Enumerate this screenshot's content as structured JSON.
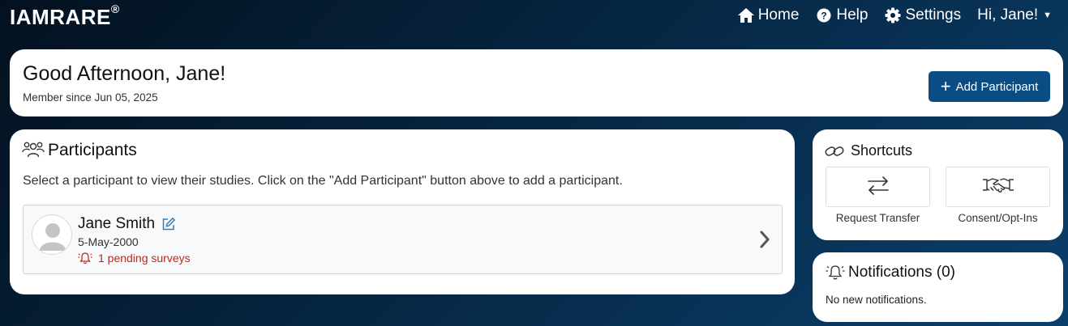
{
  "brand": {
    "name": "IAMRARE",
    "mark": "®"
  },
  "nav": {
    "home": "Home",
    "help": "Help",
    "settings": "Settings",
    "user": "Hi, Jane!"
  },
  "welcome": {
    "greeting": "Good Afternoon, Jane!",
    "member_since": "Member since Jun 05, 2025",
    "add_button": "Add Participant"
  },
  "participants": {
    "title": "Participants",
    "description": "Select a participant to view their studies. Click on the \"Add Participant\" button above to add a participant.",
    "items": [
      {
        "name": "Jane Smith",
        "dob": "5-May-2000",
        "pending": "1 pending surveys"
      }
    ]
  },
  "shortcuts": {
    "title": "Shortcuts",
    "items": [
      {
        "label": "Request Transfer",
        "icon": "transfer-arrows-icon"
      },
      {
        "label": "Consent/Opt-Ins",
        "icon": "handshake-icon"
      }
    ]
  },
  "notifications": {
    "title": "Notifications (0)",
    "empty_text": "No new notifications."
  },
  "colors": {
    "primary": "#0a4d85",
    "alert": "#c0281b",
    "edit_icon": "#2f7fc1"
  }
}
